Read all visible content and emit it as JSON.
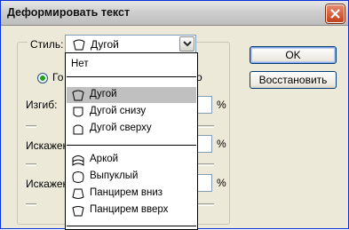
{
  "window": {
    "title": "Деформировать текст"
  },
  "style": {
    "label": "Стиль:",
    "selected": "Дугой",
    "selected_icon": "arc-shape-icon"
  },
  "orientation": {
    "horizontal_label_partial": "Го",
    "vertical_label_partial": "о"
  },
  "params": {
    "bend_label": "Изгиб:",
    "hdist_label": "Искажен",
    "vdist_label": "Искажен",
    "unit": "%"
  },
  "buttons": {
    "ok": "OK",
    "reset": "Восстановить"
  },
  "dropdown": {
    "items": [
      {
        "label": "Нет",
        "icon": ""
      },
      {
        "label": "Дугой",
        "icon": "arc-shape-icon",
        "selected": true
      },
      {
        "label": "Дугой снизу",
        "icon": "arc-lower-shape-icon"
      },
      {
        "label": "Дугой сверху",
        "icon": "arc-upper-shape-icon"
      },
      {
        "label": "Аркой",
        "icon": "arch-shape-icon"
      },
      {
        "label": "Выпуклый",
        "icon": "bulge-shape-icon"
      },
      {
        "label": "Панцирем вниз",
        "icon": "shell-lower-shape-icon"
      },
      {
        "label": "Панцирем вверх",
        "icon": "shell-upper-shape-icon"
      }
    ]
  },
  "colors": {
    "selected_bg": "#c0c0c0",
    "close_red": "#c2401c",
    "radio_dot": "#21a121"
  }
}
